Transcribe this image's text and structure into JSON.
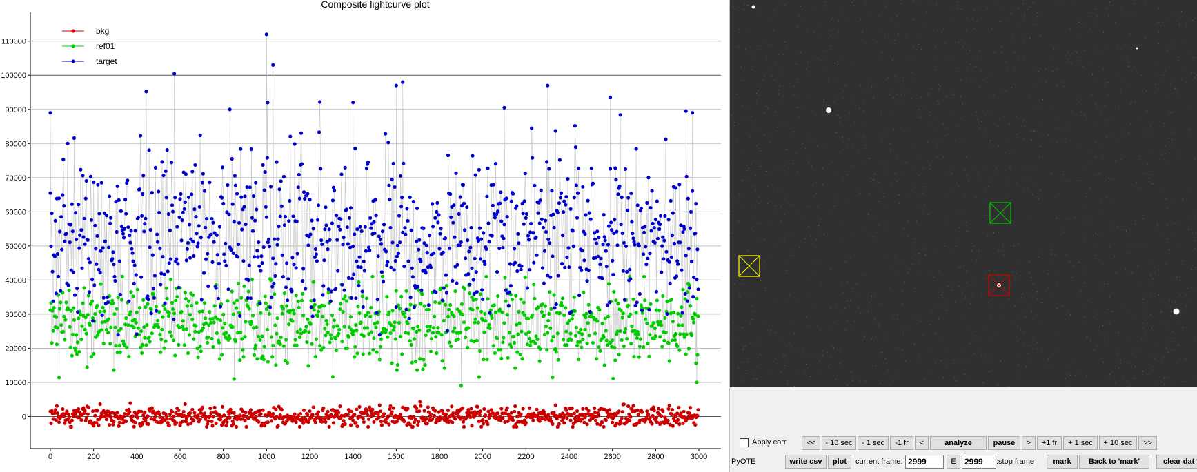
{
  "plot": {
    "title": "Composite lightcurve plot",
    "legend": [
      {
        "label": "bkg",
        "color": "#cc0000"
      },
      {
        "label": "ref01",
        "color": "#00cc00"
      },
      {
        "label": "target",
        "color": "#0000cc"
      }
    ],
    "x_ticks": [
      "0",
      "200",
      "400",
      "600",
      "800",
      "1000",
      "1200",
      "1400",
      "1600",
      "1800",
      "2000",
      "2200",
      "2400",
      "2600",
      "2800",
      "3000"
    ],
    "y_ticks": [
      "0",
      "10000",
      "20000",
      "30000",
      "40000",
      "50000",
      "60000",
      "70000",
      "80000",
      "90000",
      "100000",
      "110000"
    ]
  },
  "chart_data": {
    "type": "scatter",
    "title": "Composite lightcurve plot",
    "xlabel": "",
    "ylabel": "",
    "xlim": [
      0,
      3000
    ],
    "ylim": [
      -8000,
      116000
    ],
    "grid": true,
    "legend_position": "top-left",
    "series": [
      {
        "name": "bkg",
        "color": "#cc0000",
        "center": 0,
        "spread": 1500,
        "min": -3000,
        "max": 4500
      },
      {
        "name": "ref01",
        "color": "#00cc00",
        "center": 27000,
        "spread": 6000,
        "min": 9500,
        "max": 41000
      },
      {
        "name": "target",
        "color": "#0000cc",
        "center": 53000,
        "spread": 12000,
        "min": 24000,
        "max": 112000
      }
    ],
    "n_frames": 3000,
    "notable_points": [
      {
        "series": "target",
        "x": 1000,
        "y": 112000
      },
      {
        "series": "target",
        "x": 1030,
        "y": 103000
      },
      {
        "series": "target",
        "x": 1005,
        "y": 92000
      },
      {
        "series": "target",
        "x": 1630,
        "y": 98000
      },
      {
        "series": "target",
        "x": 1600,
        "y": 97000
      },
      {
        "series": "target",
        "x": 2300,
        "y": 97000
      },
      {
        "series": "target",
        "x": 2590,
        "y": 93500
      },
      {
        "series": "target",
        "x": 2940,
        "y": 89500
      },
      {
        "series": "target",
        "x": 2970,
        "y": 89000
      },
      {
        "series": "target",
        "x": 830,
        "y": 90000
      },
      {
        "series": "target",
        "x": 0,
        "y": 89000
      },
      {
        "series": "target",
        "x": 1400,
        "y": 92000
      },
      {
        "series": "target",
        "x": 2100,
        "y": 90500
      },
      {
        "series": "ref01",
        "x": 2990,
        "y": 10000
      },
      {
        "series": "ref01",
        "x": 1900,
        "y": 9000
      },
      {
        "series": "ref01",
        "x": 850,
        "y": 11000
      }
    ]
  },
  "image_view": {
    "background": "#303030",
    "apertures": [
      {
        "name": "yellow-aperture",
        "color": "#ffff00"
      },
      {
        "name": "green-aperture",
        "color": "#00cc00"
      },
      {
        "name": "red-aperture",
        "color": "#cc0000"
      }
    ]
  },
  "controls": {
    "apply_corr_label": "Apply corr",
    "pyote_label": "PyOTE",
    "nav_buttons": {
      "back_start": "<<",
      "minus_10_sec": "- 10 sec",
      "minus_1_sec": "- 1 sec",
      "minus_1_fr": "-1 fr",
      "step_back": "<",
      "analyze": "analyze",
      "pause": "pause",
      "step_fwd": ">",
      "plus_1_fr": "+1 fr",
      "plus_1_sec": "+ 1 sec",
      "plus_10_sec": "+ 10 sec",
      "fwd_end": ">>"
    },
    "write_csv": "write csv",
    "plot": "plot",
    "current_frame_label": "current frame:",
    "current_frame_value": "2999",
    "e_button": "E",
    "stop_frame_value": "2999",
    "stop_frame_label": ":stop frame",
    "mark": "mark",
    "back_to_mark": "Back to 'mark'",
    "clear_data": "clear dat"
  }
}
